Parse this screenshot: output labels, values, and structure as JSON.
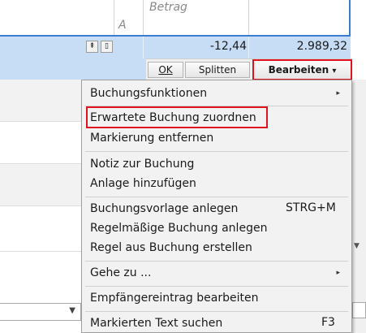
{
  "register": {
    "amount_header": "Betrag",
    "column_a": "A",
    "amount_value": "-12,44",
    "balance_value": "2.989,32"
  },
  "toolbar": {
    "ok_label": "OK",
    "split_label": "Splitten",
    "edit_label": "Bearbeiten",
    "edit_arrow": "▾"
  },
  "menu": {
    "items": [
      {
        "label": "Buchungsfunktionen",
        "submenu": "▸"
      },
      {
        "label": "Erwartete Buchung zuordnen"
      },
      {
        "label": "Markierung entfernen"
      },
      {
        "label": "Notiz zur Buchung"
      },
      {
        "label": "Anlage hinzufügen"
      },
      {
        "label": "Buchungsvorlage anlegen",
        "shortcut": "STRG+M"
      },
      {
        "label": "Regelmäßige Buchung anlegen"
      },
      {
        "label": "Regel aus Buchung erstellen"
      },
      {
        "label": "Gehe zu ...",
        "submenu": "▸"
      },
      {
        "label": "Empfängereintrag bearbeiten"
      },
      {
        "label": "Markierten Text suchen",
        "shortcut": "F3"
      }
    ]
  },
  "colors": {
    "highlight_red": "#e0141e",
    "selection_blue": "#c7dcf5",
    "accent_blue": "#3b7fd4"
  }
}
